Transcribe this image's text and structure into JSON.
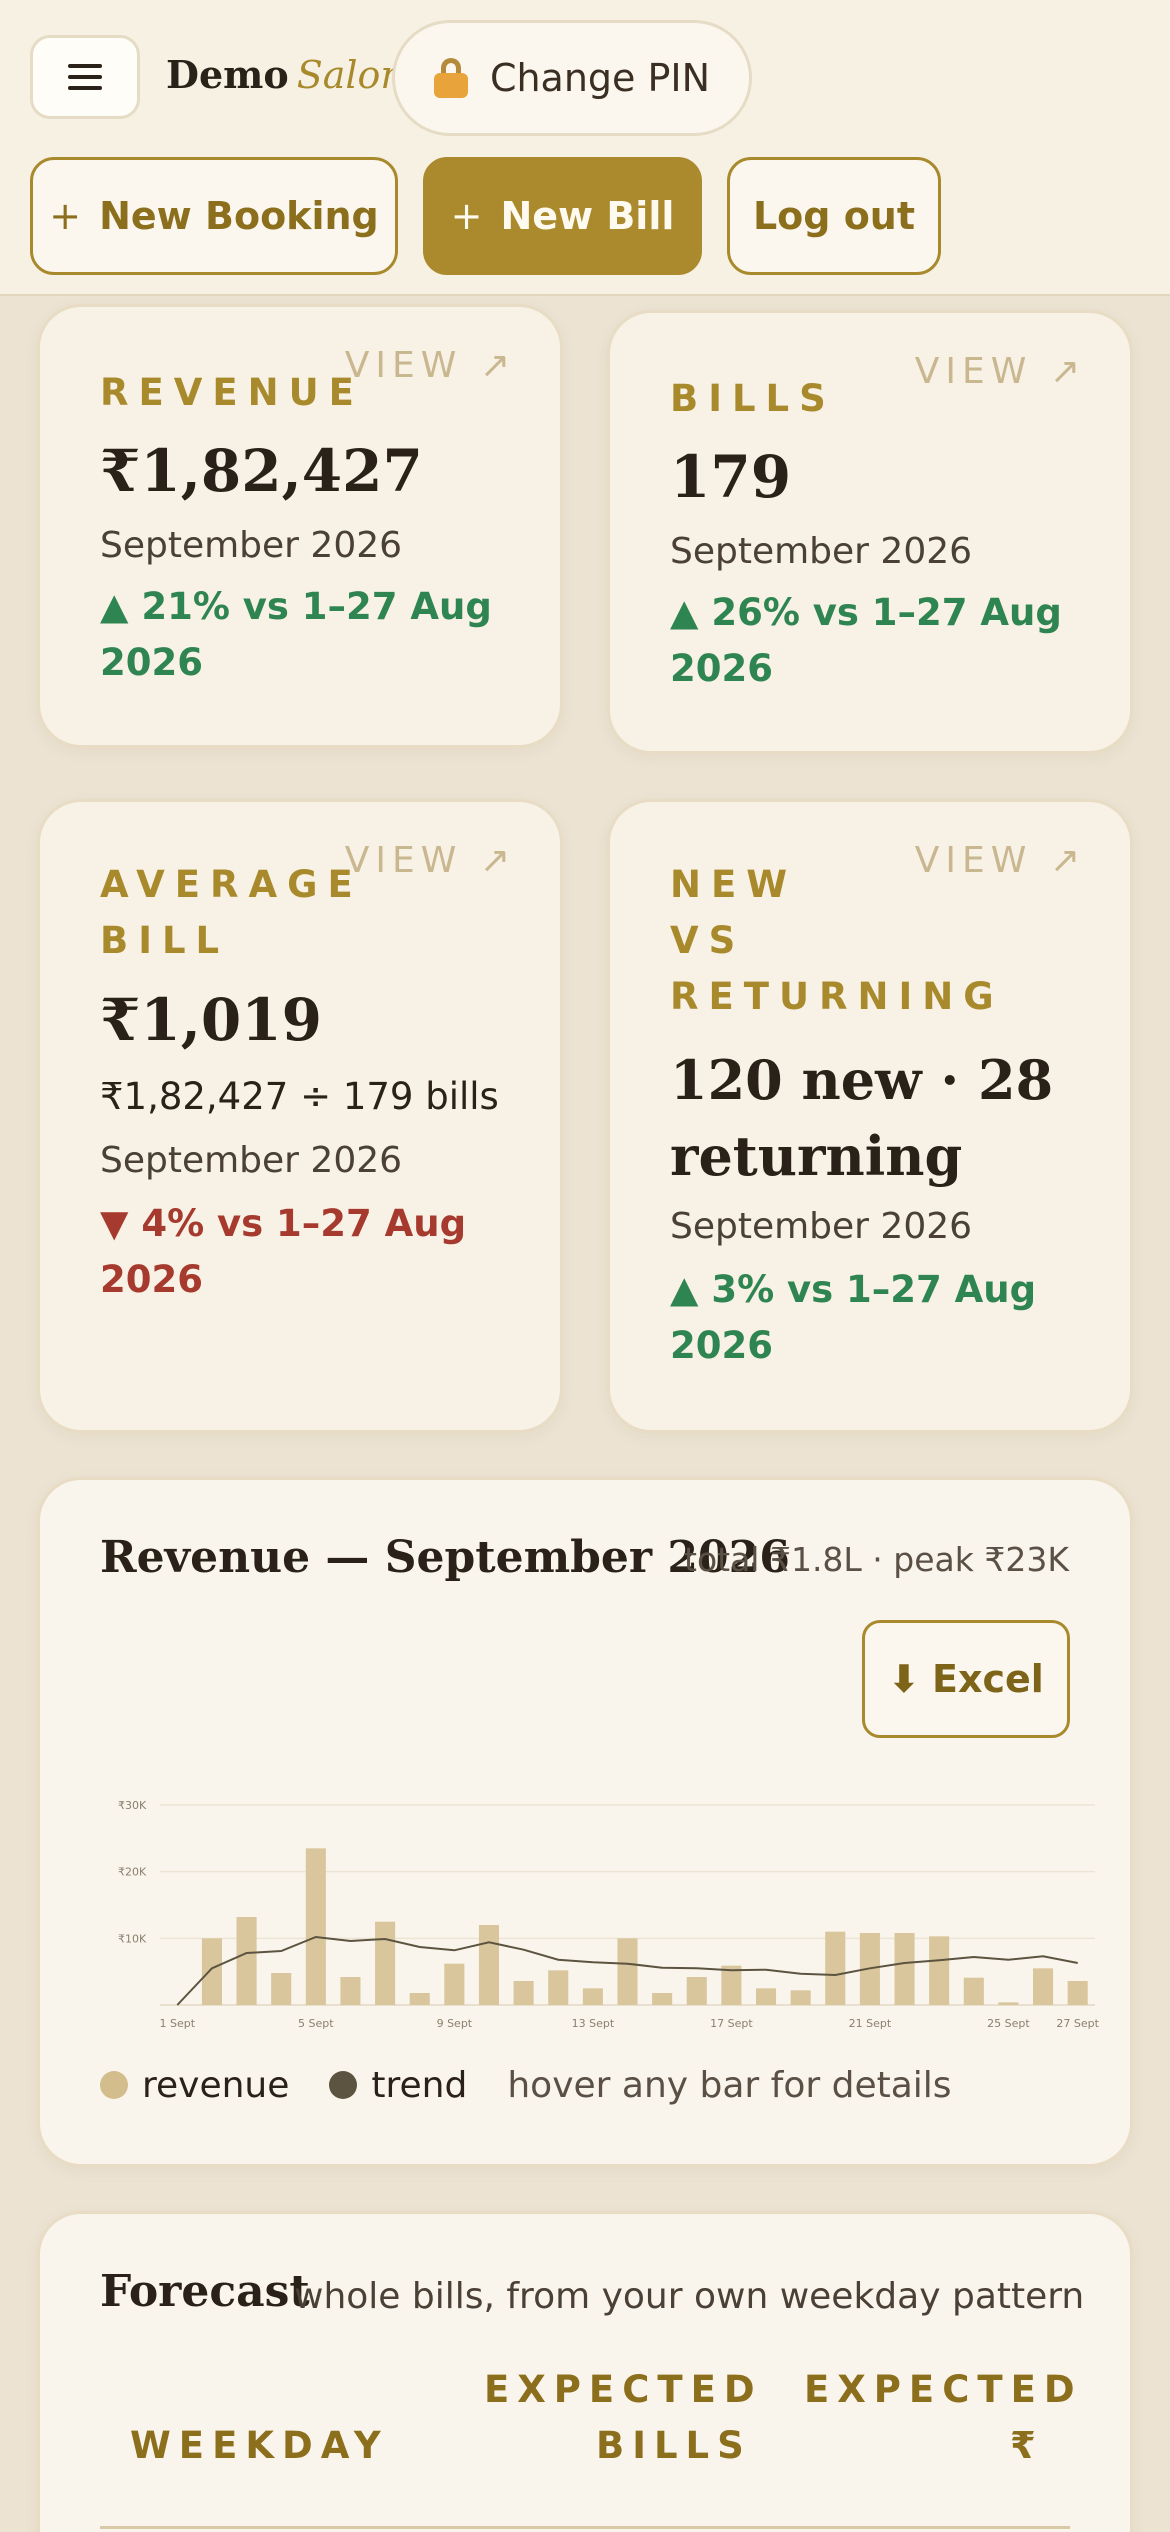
{
  "header": {
    "brand_primary": "Demo",
    "brand_accent": "Salon",
    "change_pin_label": "Change PIN",
    "new_booking_label": "New Booking",
    "new_bill_label": "New Bill",
    "logout_label": "Log out",
    "plus_glyph": "+"
  },
  "stats": {
    "view_label": "VIEW ↗",
    "revenue": {
      "label": "REVENUE",
      "value": "₹1,82,427",
      "period": "September 2026",
      "change": "▲ 21% vs 1–27 Aug 2026"
    },
    "bills": {
      "label": "BILLS",
      "value": "179",
      "period": "September 2026",
      "change": "▲ 26% vs 1–27 Aug 2026"
    },
    "average_bill": {
      "label_line1": "AVERAGE",
      "label_line2": "BILL",
      "value": "₹1,019",
      "calc": "₹1,82,427 ÷ 179 bills",
      "period": "September 2026",
      "change": "▼ 4% vs 1–27 Aug 2026"
    },
    "new_vs_returning": {
      "label_line1": "NEW",
      "label_line2": "VS",
      "label_line3": "RETURNING",
      "value_line1": "120 new · 28",
      "value_line2": "returning",
      "period": "September 2026",
      "change": "▲ 3% vs 1–27 Aug 2026"
    }
  },
  "revenue_chart": {
    "title": "Revenue — September 2026",
    "meta": "total ₹1.8L · peak ₹23K",
    "excel_label": "Excel",
    "legend_revenue": "revenue",
    "legend_trend": "trend",
    "hint": "hover any bar for details",
    "colors": {
      "bar": "#d9c69c",
      "trend": "#5c5440",
      "grid": "#ece4d4"
    }
  },
  "chart_data": {
    "type": "bar",
    "x": [
      "1 Sept",
      "2 Sept",
      "3 Sept",
      "4 Sept",
      "5 Sept",
      "6 Sept",
      "7 Sept",
      "8 Sept",
      "9 Sept",
      "10 Sept",
      "11 Sept",
      "12 Sept",
      "13 Sept",
      "14 Sept",
      "15 Sept",
      "16 Sept",
      "17 Sept",
      "18 Sept",
      "19 Sept",
      "20 Sept",
      "21 Sept",
      "22 Sept",
      "23 Sept",
      "24 Sept",
      "25 Sept",
      "26 Sept",
      "27 Sept"
    ],
    "x_tick_labels": [
      "1 Sept",
      "5 Sept",
      "9 Sept",
      "13 Sept",
      "17 Sept",
      "21 Sept",
      "25 Sept",
      "27 Sept"
    ],
    "y_tick_labels": [
      "₹10K",
      "₹20K",
      "₹30K"
    ],
    "series": [
      {
        "name": "revenue",
        "values": [
          0,
          10000,
          13200,
          4800,
          23500,
          4200,
          12500,
          1800,
          6200,
          12000,
          3600,
          5200,
          2500,
          10000,
          1800,
          4200,
          5900,
          2500,
          2200,
          11000,
          10800,
          10800,
          10300,
          4100,
          400,
          5500,
          3600
        ]
      },
      {
        "name": "trend",
        "values": [
          0,
          5500,
          7800,
          8100,
          10200,
          9600,
          9900,
          8700,
          8200,
          9400,
          8300,
          6800,
          6400,
          6200,
          5600,
          5500,
          5200,
          5300,
          4700,
          4500,
          5500,
          6300,
          6700,
          7200,
          6800,
          7300,
          6300
        ]
      }
    ],
    "ylim": [
      0,
      30000
    ],
    "xlabel": "",
    "ylabel": "",
    "grid": true
  },
  "forecast": {
    "title": "Forecast",
    "subtitle": "whole bills, from your own weekday pattern",
    "col_weekday": "WEEKDAY",
    "col_bills_line1": "EXPECTED",
    "col_bills_line2": "BILLS",
    "col_amount_line1": "EXPECTED",
    "col_amount_line2": "₹"
  }
}
